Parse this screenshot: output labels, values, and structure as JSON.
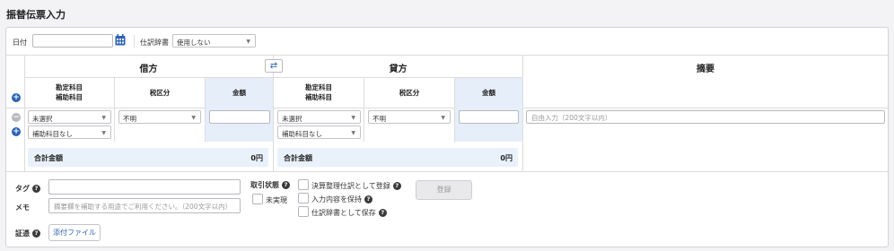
{
  "page": {
    "title": "振替伝票入力"
  },
  "form": {
    "date_label": "日付",
    "date_value": "",
    "dict_label": "仕訳辞書",
    "dict_selected": "使用しない"
  },
  "table": {
    "debit_header": "借方",
    "credit_header": "貸方",
    "summary_header": "摘要",
    "account_header_line1": "勘定科目",
    "account_header_line2": "補助科目",
    "tax_header": "税区分",
    "amount_header": "金額",
    "debit": {
      "account": "未選択",
      "sub_account": "補助科目なし",
      "tax": "不明",
      "amount": ""
    },
    "credit": {
      "account": "未選択",
      "sub_account": "補助科目なし",
      "tax": "不明",
      "amount": ""
    },
    "summary_placeholder": "自由入力（200文字以内）",
    "total_label": "合計金額",
    "debit_total": "0円",
    "credit_total": "0円"
  },
  "bottom": {
    "tag_label": "タグ",
    "memo_label": "メモ",
    "memo_placeholder": "摘要欄を補助する用途でご利用ください。（200文字以内）",
    "evidence_label": "証憑",
    "attach_button": "添付ファイル",
    "status_label": "取引状態",
    "unrealized_label": "未実現",
    "settlement_label": "決算整理仕訳として登録",
    "keep_input_label": "入力内容を保持",
    "save_dict_label": "仕訳辞書として保存",
    "register_button": "登録"
  },
  "icons": {
    "calendar": "calendar-icon",
    "swap": "swap-icon",
    "add": "add-row-icon",
    "remove": "remove-row-icon",
    "help": "help-icon"
  },
  "colors": {
    "accent": "#2b63b5",
    "header_blue_bg": "#e6eefa",
    "disabled_button": "#e9e9eb"
  }
}
